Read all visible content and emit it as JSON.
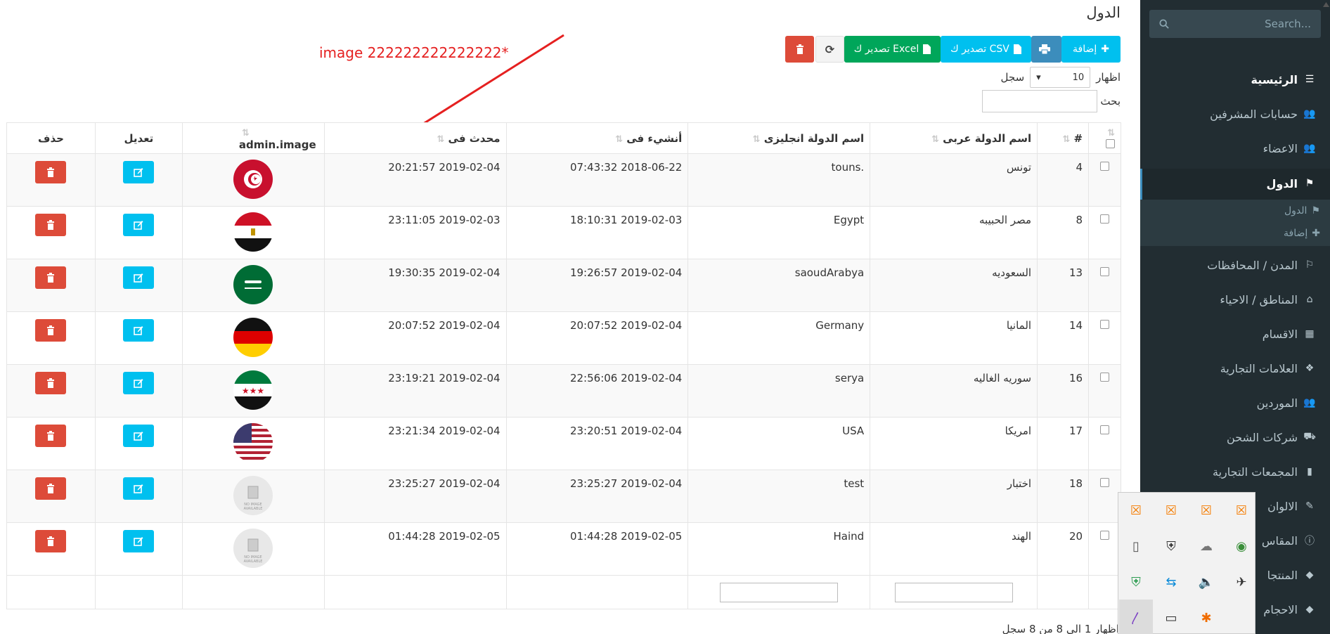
{
  "sidebar": {
    "search_placeholder": "Search...",
    "items": [
      {
        "label": "الرئيسية",
        "icon": "list-icon"
      },
      {
        "label": "حسابات المشرفين",
        "icon": "users-icon"
      },
      {
        "label": "الاعضاء",
        "icon": "users-icon"
      },
      {
        "label": "الدول",
        "icon": "flag-icon"
      },
      {
        "label": "المدن / المحافظات",
        "icon": "flag-outline-icon"
      },
      {
        "label": "المناطق / الاحياء",
        "icon": "building-icon"
      },
      {
        "label": "الاقسام",
        "icon": "grid-icon"
      },
      {
        "label": "العلامات التجارية",
        "icon": "cubes-icon"
      },
      {
        "label": "الموردين",
        "icon": "users-icon"
      },
      {
        "label": "شركات الشحن",
        "icon": "truck-icon"
      },
      {
        "label": "المجمعات التجارية",
        "icon": "book-icon"
      },
      {
        "label": "الالوان",
        "icon": "brush-icon"
      },
      {
        "label": "المقاس",
        "icon": "info-icon"
      },
      {
        "label": "المنتجا",
        "icon": "tag-icon"
      },
      {
        "label": "الاحجام",
        "icon": "tag-icon"
      }
    ],
    "sub_items": [
      {
        "label": "الدول",
        "icon": "flag-outline-icon"
      },
      {
        "label": "إضافة",
        "icon": "plus-icon"
      }
    ]
  },
  "page": {
    "title": "الدول",
    "annotation": "image 222222222222222*",
    "info": "اظهار 1 الى 8 من 8 سجل"
  },
  "toolbar": {
    "add": "إضافة",
    "print": "",
    "csv": "تصدير ك CSV",
    "excel": "تصدير ك Excel"
  },
  "length": {
    "show": "اظهار",
    "value": "10",
    "records": "سجل"
  },
  "search": {
    "label": "بحث"
  },
  "table": {
    "headers": {
      "id": "#",
      "name_ar": "اسم الدولة عربى",
      "name_en": "اسم الدولة انجليزى",
      "created": "أنشيء فى",
      "updated": "محدث فى",
      "image": "admin.image",
      "edit": "تعديل",
      "delete": "حذف"
    },
    "rows": [
      {
        "id": "4",
        "name_ar": "تونس",
        "name_en": ".touns",
        "created": "2018-06-22 07:43:32",
        "updated": "2019-02-04 20:21:57",
        "flag": "tunisia"
      },
      {
        "id": "8",
        "name_ar": "مصر الحبيبه",
        "name_en": "Egypt",
        "created": "2019-02-03 18:10:31",
        "updated": "2019-02-03 23:11:05",
        "flag": "egypt"
      },
      {
        "id": "13",
        "name_ar": "السعوديه",
        "name_en": "saoudArabya",
        "created": "2019-02-04 19:26:57",
        "updated": "2019-02-04 19:30:35",
        "flag": "saudi"
      },
      {
        "id": "14",
        "name_ar": "المانيا",
        "name_en": "Germany",
        "created": "2019-02-04 20:07:52",
        "updated": "2019-02-04 20:07:52",
        "flag": "germany"
      },
      {
        "id": "16",
        "name_ar": "سوريه الغاليه",
        "name_en": "serya",
        "created": "2019-02-04 22:56:06",
        "updated": "2019-02-04 23:19:21",
        "flag": "syria"
      },
      {
        "id": "17",
        "name_ar": "امريكا",
        "name_en": "USA",
        "created": "2019-02-04 23:20:51",
        "updated": "2019-02-04 23:21:34",
        "flag": "usa"
      },
      {
        "id": "18",
        "name_ar": "اختبار",
        "name_en": "test",
        "created": "2019-02-04 23:25:27",
        "updated": "2019-02-04 23:25:27",
        "flag": "noimage"
      },
      {
        "id": "20",
        "name_ar": "الهند",
        "name_en": "Haind",
        "created": "2019-02-05 01:44:28",
        "updated": "2019-02-05 01:44:28",
        "flag": "noimage"
      }
    ]
  },
  "colors": {
    "sidebar_bg": "#222d32",
    "info_blue": "#00c0ef",
    "primary": "#3c8dbc",
    "success": "#00a65a",
    "danger": "#dd4b39"
  }
}
